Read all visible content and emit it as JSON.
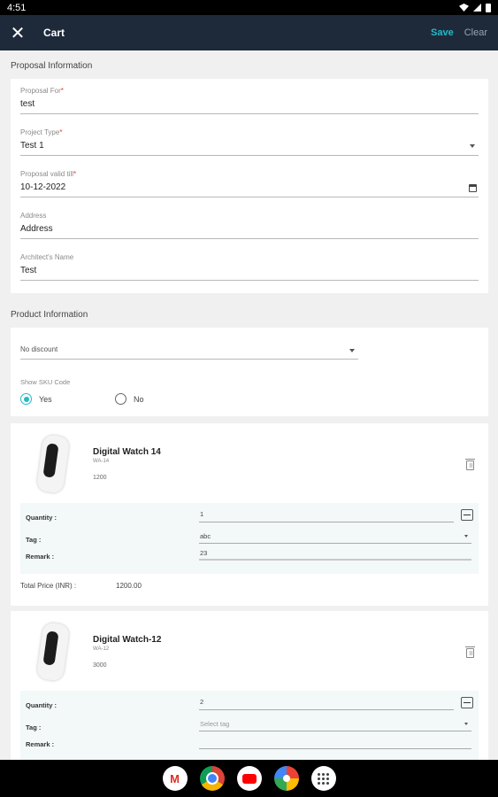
{
  "status_bar": {
    "time": "4:51"
  },
  "app_bar": {
    "title": "Cart",
    "save_label": "Save",
    "clear_label": "Clear"
  },
  "proposal": {
    "section_title": "Proposal Information",
    "fields": [
      {
        "label": "Proposal For",
        "required": "*",
        "value": "test"
      },
      {
        "label": "Project Type",
        "required": "*",
        "value": "Test 1"
      },
      {
        "label": "Proposal valid till",
        "required": "*",
        "value": "10-12-2022"
      },
      {
        "label": "Address",
        "required": "",
        "value": "Address"
      },
      {
        "label": "Architect's Name",
        "required": "",
        "value": "Test"
      }
    ]
  },
  "product_info": {
    "section_title": "Product Information",
    "discount_value": "No discount",
    "show_sku_label": "Show SKU Code",
    "show_sku_options": [
      "Yes",
      "No"
    ],
    "show_sku_selected": "Yes"
  },
  "products": [
    {
      "name": "Digital Watch 14",
      "sku": "WA-14",
      "price": "1200",
      "quantity_label": "Quantity :",
      "quantity": "1",
      "tag_label": "Tag :",
      "tag": "abc",
      "remark_label": "Remark :",
      "remark": "23",
      "total_label": "Total Price (INR) :",
      "total_value": "1200.00"
    },
    {
      "name": "Digital Watch-12",
      "sku": "WA-12",
      "price": "3000",
      "quantity_label": "Quantity :",
      "quantity": "2",
      "tag_label": "Tag :",
      "tag_placeholder": "Select tag",
      "remark_label": "Remark :",
      "remark": ""
    }
  ],
  "dock": {
    "apps": [
      "gmail-icon",
      "chrome-icon",
      "youtube-icon",
      "photos-icon",
      "apps-icon"
    ],
    "gmail_glyph": "M"
  }
}
